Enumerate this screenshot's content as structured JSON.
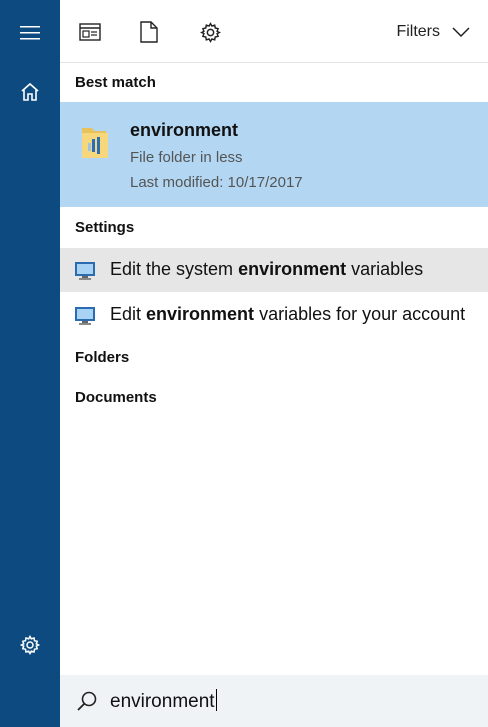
{
  "colors": {
    "rail": "#0c4a80",
    "selected": "#b3d7f3",
    "hover": "#e6e6e6",
    "search_bg": "#f0f3f6"
  },
  "rail": {
    "menu_icon": "hamburger-icon",
    "home_icon": "home-icon",
    "settings_icon": "gear-icon"
  },
  "toolbar": {
    "icons": [
      "apps-icon",
      "document-icon",
      "gear-icon"
    ],
    "filters_label": "Filters"
  },
  "best_match": {
    "header": "Best match",
    "title": "environment",
    "subtitle": "File folder in less",
    "modified": "Last modified: 10/17/2017"
  },
  "settings": {
    "header": "Settings",
    "items": [
      {
        "pre": "Edit the system ",
        "bold": "environment",
        "post": " variables"
      },
      {
        "pre": "Edit ",
        "bold": "environment",
        "post": " variables for your account"
      }
    ]
  },
  "folders_header": "Folders",
  "documents_header": "Documents",
  "search": {
    "value": "environment"
  }
}
